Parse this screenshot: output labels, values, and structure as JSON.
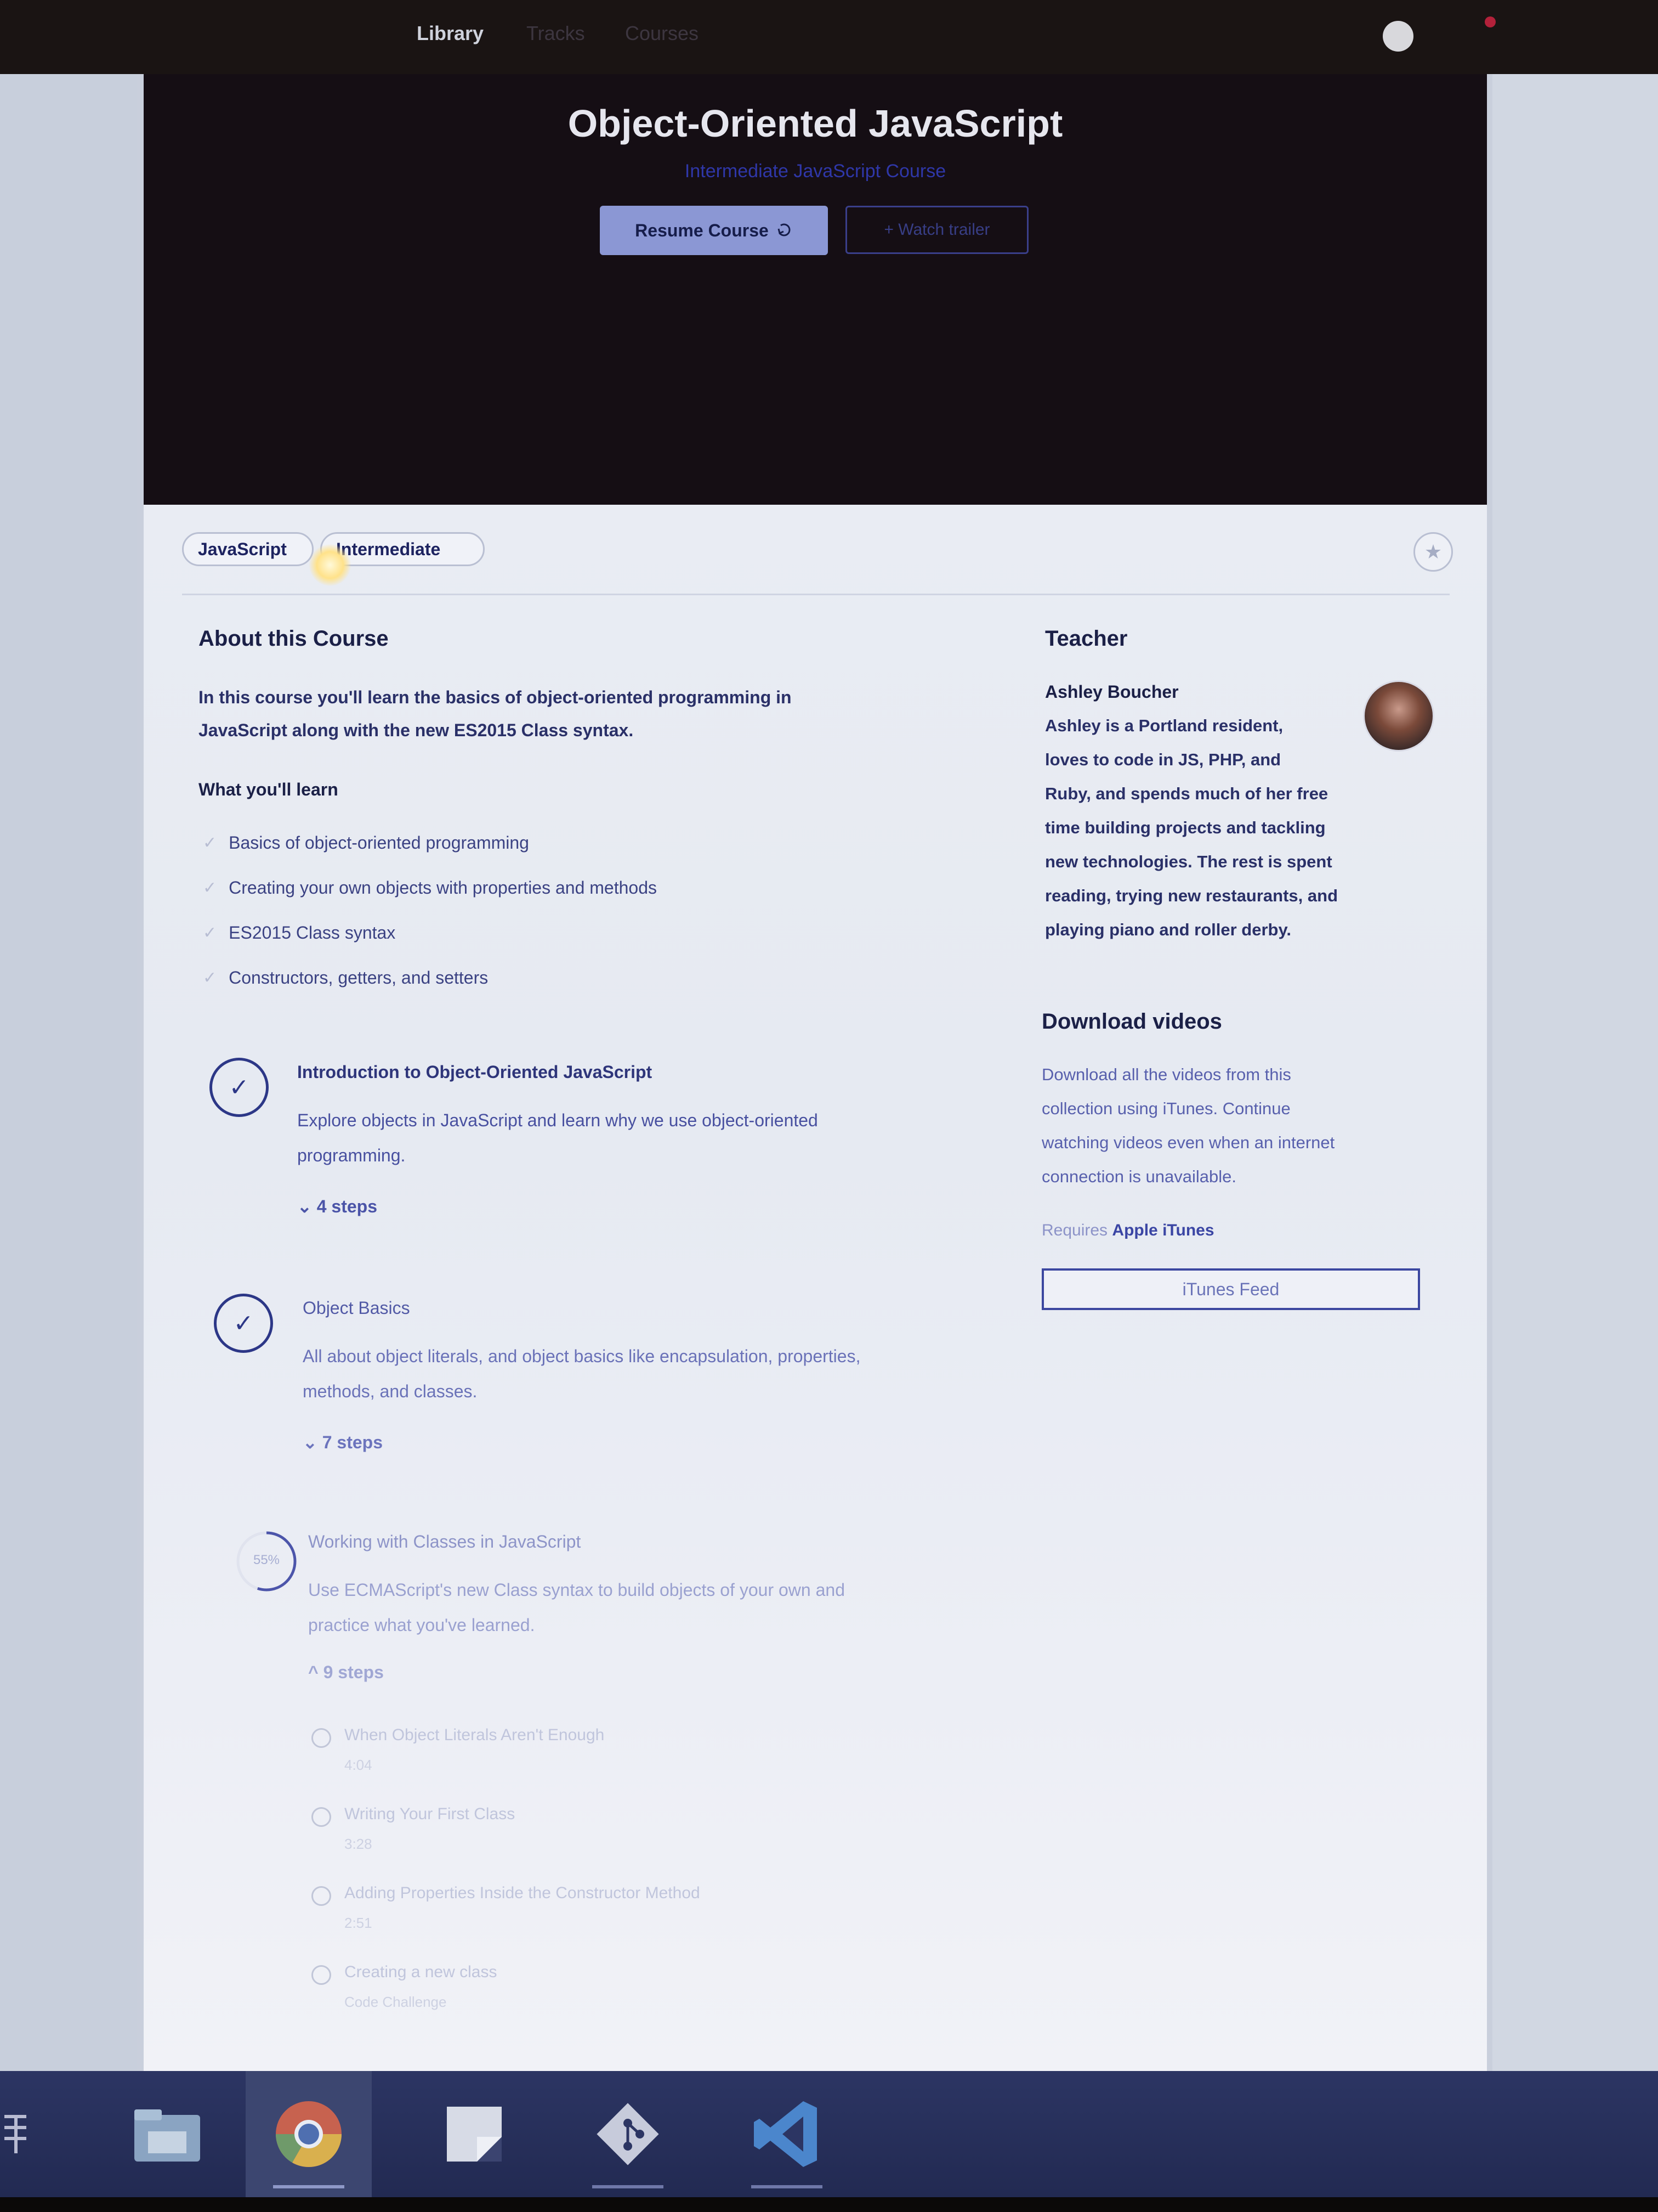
{
  "topbar": {
    "library_label": "Library",
    "faded_labels": [
      "Tracks",
      "Courses"
    ]
  },
  "hero": {
    "title": "Object-Oriented JavaScript",
    "subtitle": "Intermediate JavaScript Course",
    "resume_label": "Resume Course",
    "watch_label": "+ Watch trailer"
  },
  "tags": {
    "topic": "JavaScript",
    "level": "Intermediate"
  },
  "about": {
    "heading": "About this Course",
    "description_line1": "In this course you'll learn the basics of object-oriented programming in",
    "description_line2": "JavaScript along with the new ES2015 Class syntax.",
    "learn_heading": "What you'll learn",
    "learn_items": [
      "Basics of object-oriented programming",
      "Creating your own objects with properties and methods",
      "ES2015 Class syntax",
      "Constructors, getters, and setters"
    ]
  },
  "stages": [
    {
      "title": "Introduction to Object-Oriented JavaScript",
      "desc_line1": "Explore objects in JavaScript and learn why we use object-oriented",
      "desc_line2": "programming.",
      "steps": "⌄ 4 steps"
    },
    {
      "title": "Object Basics",
      "desc_line1": "All about object literals, and object basics like encapsulation, properties,",
      "desc_line2": "methods, and classes.",
      "steps": "⌄ 7 steps"
    },
    {
      "title": "Working with Classes in JavaScript",
      "desc_line1": "Use ECMAScript's new Class syntax to build objects of your own and",
      "desc_line2": "practice what you've learned.",
      "steps": "^ 9 steps",
      "progress_label": "55%",
      "progress": 0.55
    }
  ],
  "sub_steps": [
    {
      "name": "When Object Literals Aren't Enough",
      "duration": "4:04"
    },
    {
      "name": "Writing Your First Class",
      "duration": "3:28"
    },
    {
      "name": "Adding Properties Inside the Constructor Method",
      "duration": "2:51"
    },
    {
      "name": "Creating a new class",
      "duration": "Code Challenge"
    }
  ],
  "teacher": {
    "heading": "Teacher",
    "name": "Ashley Boucher",
    "bio_lines": [
      "Ashley is a Portland resident,",
      "loves to code in JS, PHP, and",
      "Ruby, and spends much of her free",
      "time building projects and tackling",
      "new technologies. The rest is spent",
      "reading, trying new restaurants, and",
      "playing piano and roller derby."
    ]
  },
  "download": {
    "heading": "Download videos",
    "lines": [
      "Download all the videos from this",
      "collection using iTunes. Continue",
      "watching videos even when an internet",
      "connection is unavailable."
    ],
    "requires_prefix": "Requires",
    "requires_app": "Apple iTunes",
    "button_label": "iTunes Feed"
  },
  "colors": {
    "hero_bg": "#150e14",
    "accent": "#2c3787",
    "resume_button": "#8b97d4"
  },
  "taskbar": {
    "icons": [
      "folder-icon",
      "chrome-icon",
      "sticky-notes-icon",
      "git-icon",
      "vscode-icon"
    ]
  }
}
